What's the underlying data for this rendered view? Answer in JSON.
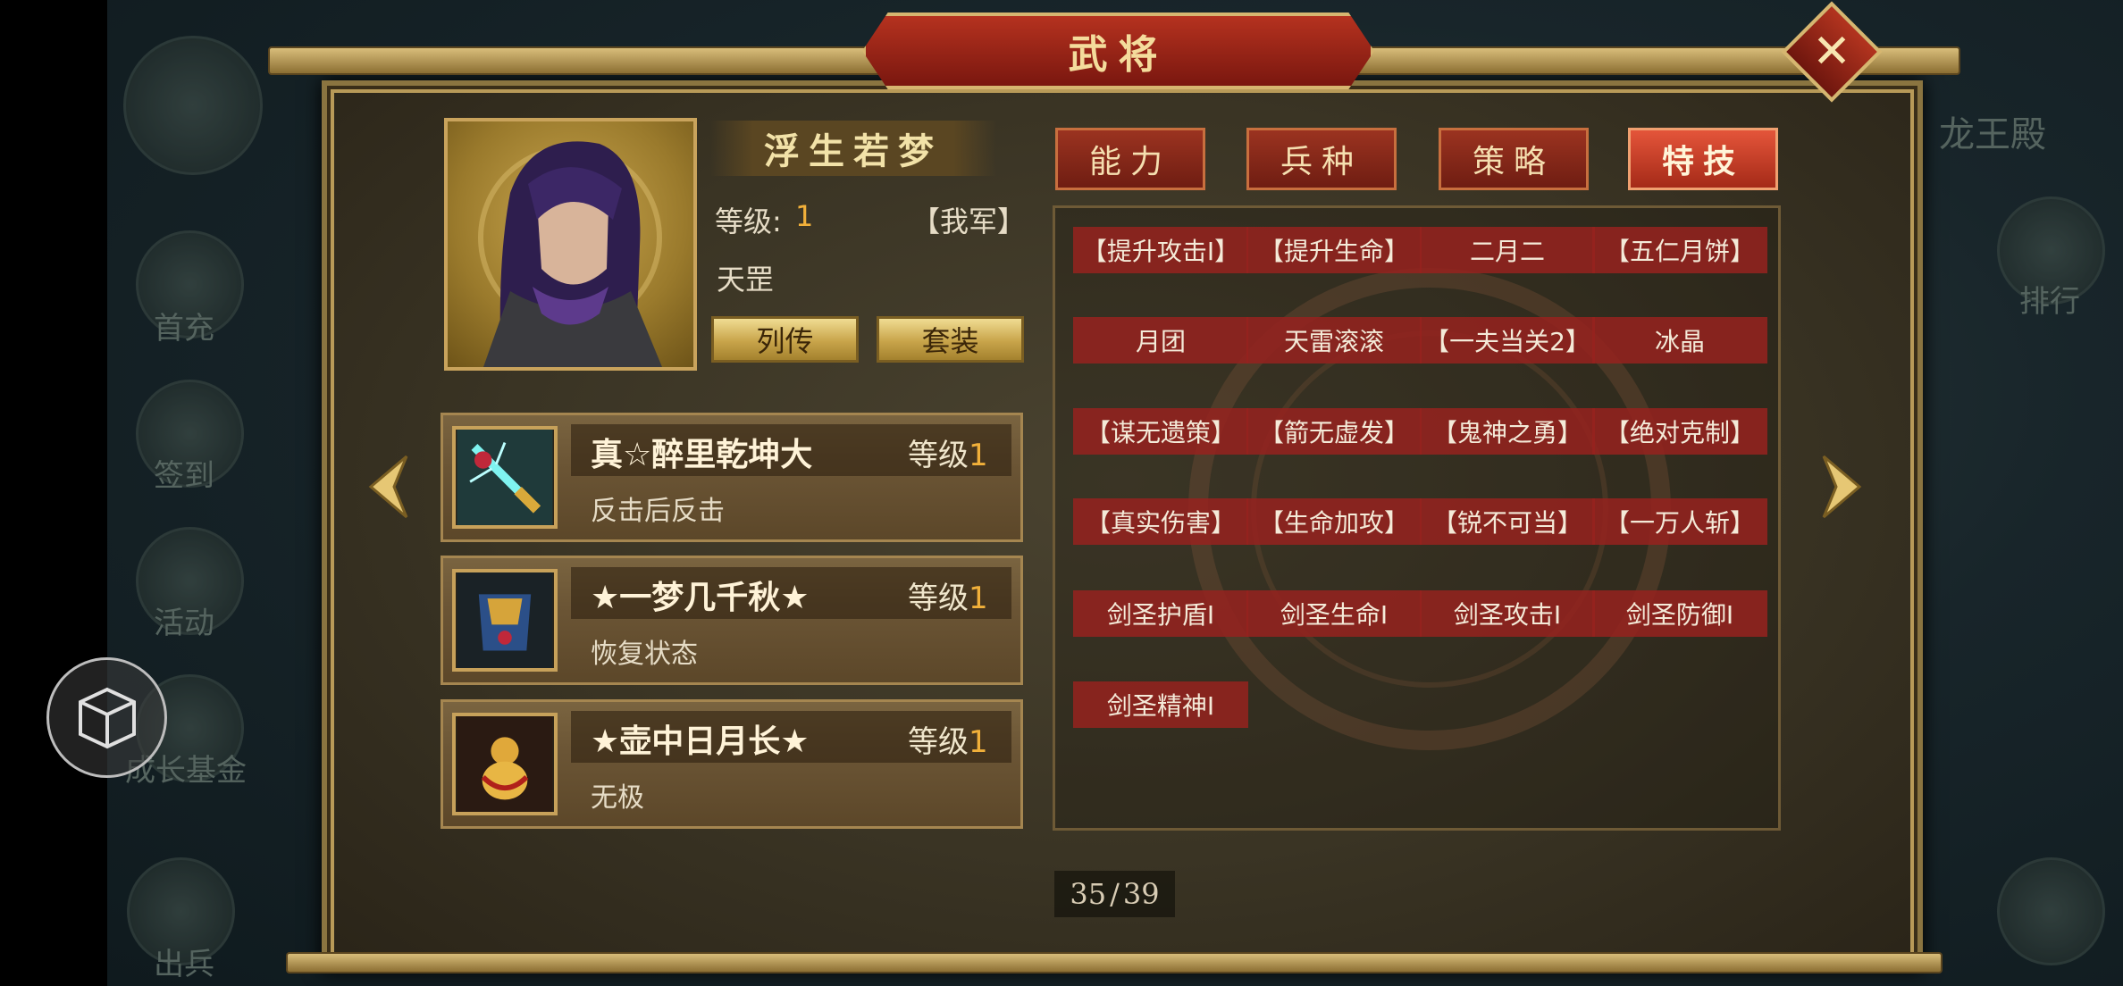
{
  "title": "武将",
  "close_icon": "close-icon",
  "hero": {
    "name": "浮生若梦",
    "level_label": "等级:",
    "level_value": "1",
    "faction": "【我军】",
    "type": "天罡"
  },
  "buttons": {
    "biography": "列传",
    "outfit": "套装"
  },
  "equipment": [
    {
      "name": "真☆醉里乾坤大",
      "level_label": "等级",
      "level": "1",
      "desc": "反击后反击",
      "icon": "sword-icon"
    },
    {
      "name": "★一梦几千秋★",
      "level_label": "等级",
      "level": "1",
      "desc": "恢复状态",
      "icon": "armor-icon"
    },
    {
      "name": "★壶中日月长★",
      "level_label": "等级",
      "level": "1",
      "desc": "无极",
      "icon": "gourd-icon"
    }
  ],
  "tabs": [
    {
      "label": "能力",
      "active": false
    },
    {
      "label": "兵种",
      "active": false
    },
    {
      "label": "策略",
      "active": false
    },
    {
      "label": "特技",
      "active": true
    }
  ],
  "skills": [
    "【提升攻击Ⅰ】",
    "【提升生命】",
    "二月二",
    "【五仁月饼】",
    "月团",
    "天雷滚滚",
    "【一夫当关2】",
    "冰晶",
    "【谋无遗策】",
    "【箭无虚发】",
    "【鬼神之勇】",
    "【绝对克制】",
    "【真实伤害】",
    "【生命加攻】",
    "【锐不可当】",
    "【一万人斩】",
    "剑圣护盾Ⅰ",
    "剑圣生命Ⅰ",
    "剑圣攻击Ⅰ",
    "剑圣防御Ⅰ",
    "剑圣精神Ⅰ"
  ],
  "pager": {
    "current": "35",
    "separator": "/",
    "total": "39"
  },
  "background": {
    "menu_labels": [
      "首充",
      "签到",
      "活动",
      "成长基金",
      "出兵",
      "排行"
    ],
    "location": "龙王殿"
  },
  "colors": {
    "accent_gold": "#d6b670",
    "tab_red": "#9b3320",
    "level_orange": "#f1b03a",
    "skill_red": "#96221e"
  }
}
